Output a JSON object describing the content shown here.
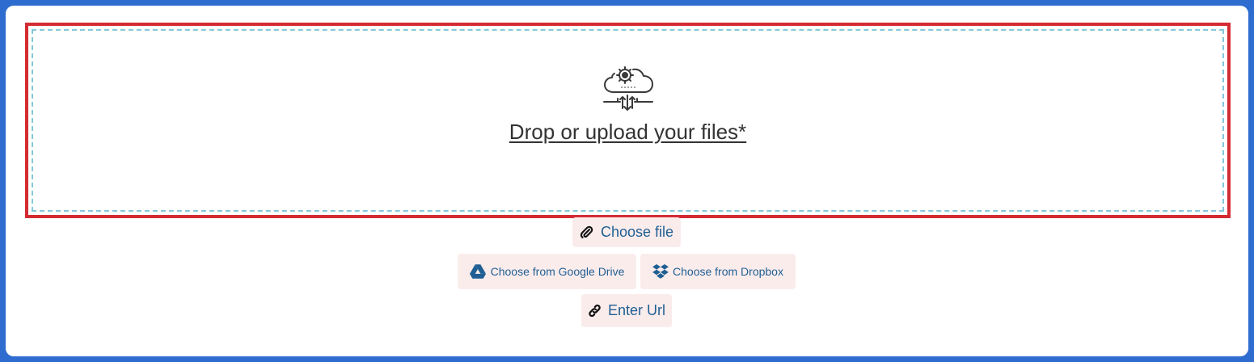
{
  "dropzone": {
    "title": "Drop or upload your files*",
    "icon": "cloud-settings-upload-icon"
  },
  "buttons": {
    "choose_file": {
      "label": "Choose file",
      "icon": "paperclip-icon"
    },
    "google_drive": {
      "label": "Choose from Google Drive",
      "icon": "google-drive-icon"
    },
    "dropbox": {
      "label": "Choose from Dropbox",
      "icon": "dropbox-icon"
    },
    "enter_url": {
      "label": "Enter Url",
      "icon": "link-icon"
    }
  },
  "colors": {
    "frame_border": "#2f6ccf",
    "dropzone_border": "#d42b32",
    "dashed_border": "#84c7d8",
    "button_bg": "#fbecec",
    "button_text": "#1f5f93"
  }
}
